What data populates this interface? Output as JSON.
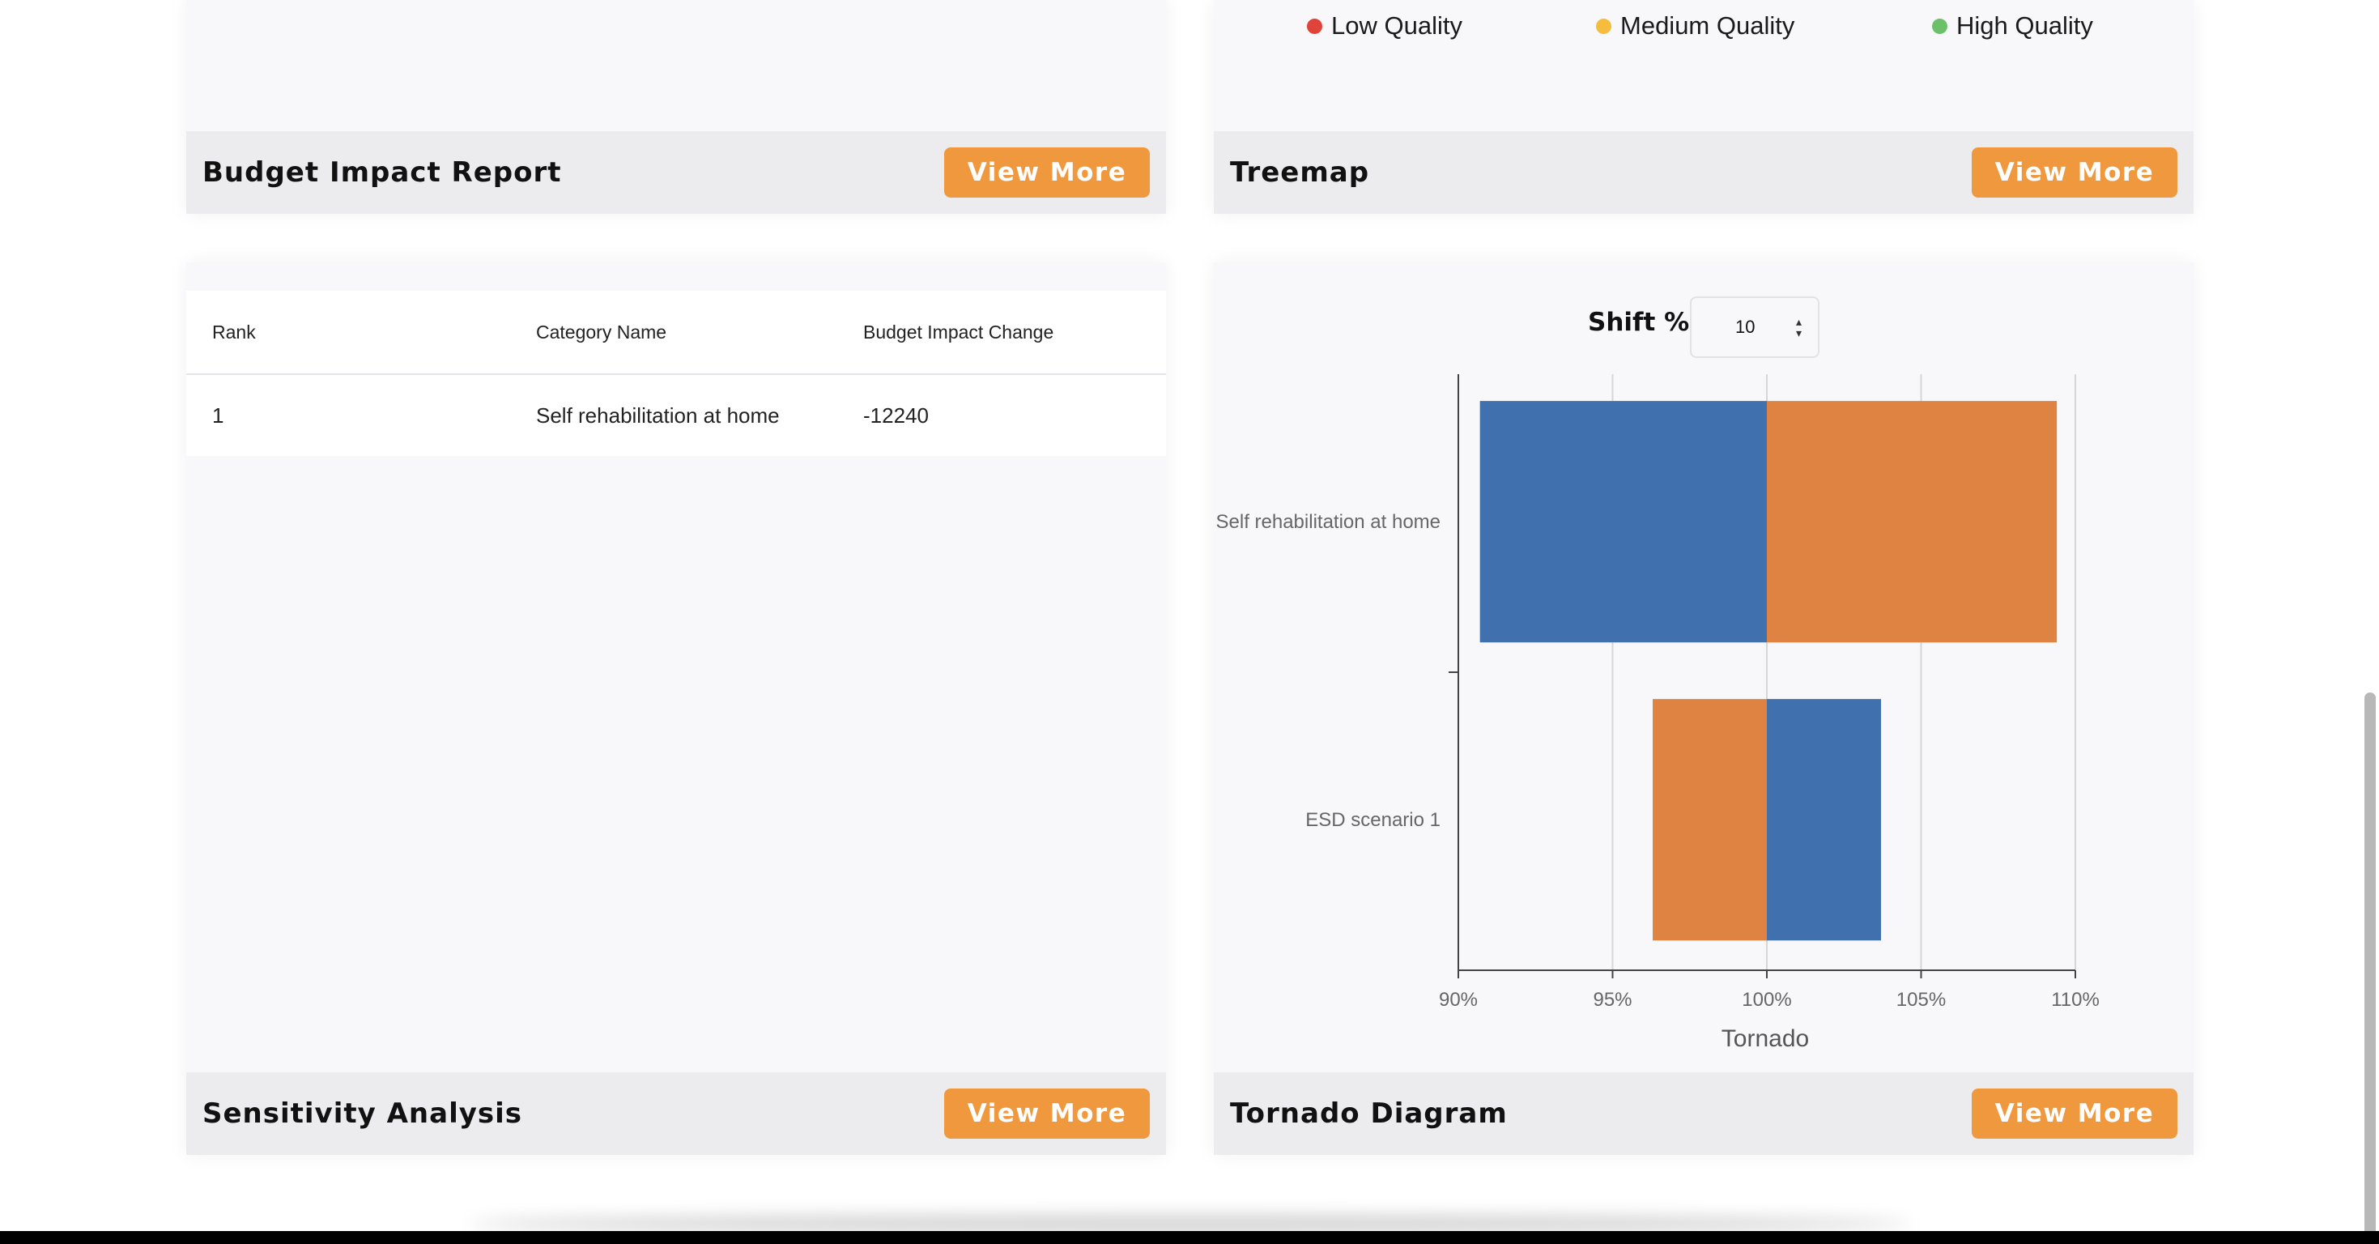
{
  "cards": {
    "budget_impact": {
      "title": "Budget Impact Report",
      "button": "View More"
    },
    "treemap": {
      "title": "Treemap",
      "button": "View More",
      "legend": [
        {
          "label": "Low Quality",
          "color": "#e0433a"
        },
        {
          "label": "Medium Quality",
          "color": "#f5bd3b"
        },
        {
          "label": "High Quality",
          "color": "#6cc06a"
        }
      ]
    },
    "sensitivity": {
      "title": "Sensitivity Analysis",
      "button": "View More",
      "table": {
        "headers": [
          "Rank",
          "Category Name",
          "Budget Impact Change"
        ],
        "rows": [
          [
            "1",
            "Self rehabilitation at home",
            "-12240"
          ]
        ]
      }
    },
    "tornado": {
      "title": "Tornado Diagram",
      "button": "View More",
      "shift_label": "Shift %",
      "shift_value": "10"
    }
  },
  "chart_data": {
    "type": "bar",
    "orientation": "horizontal",
    "xlabel": "Tornado",
    "xlim": [
      90,
      110
    ],
    "xticks": [
      "90%",
      "95%",
      "100%",
      "105%",
      "110%"
    ],
    "tick_values": [
      90,
      95,
      100,
      105,
      110
    ],
    "base": 100,
    "grid": true,
    "categories": [
      "Self rehabilitation at home",
      "ESD scenario 1"
    ],
    "bars": [
      {
        "category": "Self rehabilitation at home",
        "low": 90.7,
        "high": 109.4,
        "left_color": "#4170ae",
        "right_color": "#de8341"
      },
      {
        "category": "ESD scenario 1",
        "low": 96.3,
        "high": 103.7,
        "left_color": "#de8341",
        "right_color": "#4170ae"
      }
    ]
  }
}
